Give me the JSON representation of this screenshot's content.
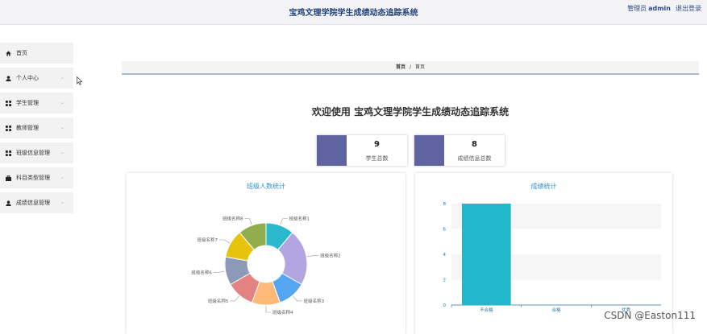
{
  "header": {
    "title": "宝鸡文理学院学生成绩动态追踪系统",
    "user_role": "管理员",
    "user_name": "admin",
    "logout": "退出登录"
  },
  "sidebar": {
    "items": [
      {
        "label": "首页",
        "icon": "home-icon"
      },
      {
        "label": "个人中心",
        "icon": "person-icon"
      },
      {
        "label": "学生管理",
        "icon": "grid-icon"
      },
      {
        "label": "教师管理",
        "icon": "grid-icon"
      },
      {
        "label": "班级信息管理",
        "icon": "grid-icon"
      },
      {
        "label": "科目类型管理",
        "icon": "briefcase-icon"
      },
      {
        "label": "成绩信息管理",
        "icon": "person-icon"
      }
    ]
  },
  "breadcrumb": {
    "first": "首页",
    "separator": "/",
    "second": "首页"
  },
  "welcome": "欢迎使用 宝鸡文理学院学生成绩动态追踪系统",
  "stats": [
    {
      "value": "9",
      "label": "学生总数"
    },
    {
      "value": "8",
      "label": "成绩信息总数"
    }
  ],
  "colors": {
    "accent": "#5f64a0",
    "title_blue": "#2a90c8",
    "bar": "#22b8cc"
  },
  "chart_data": [
    {
      "type": "pie",
      "title": "班级人数统计",
      "categories": [
        "班级名称1",
        "班级名称2",
        "班级名称3",
        "班级名称4",
        "班级名称5",
        "班级名称6",
        "班级名称7",
        "班级名称8"
      ],
      "values": [
        1,
        2,
        1,
        1,
        1,
        1,
        1,
        1
      ],
      "colors": [
        "#2ab9cc",
        "#b3a6e0",
        "#55a6f0",
        "#ffb878",
        "#e38381",
        "#8c9ab7",
        "#e6c40b",
        "#92ad4e"
      ]
    },
    {
      "type": "bar",
      "title": "成绩统计",
      "categories": [
        "不合格",
        "合格",
        "优秀"
      ],
      "values": [
        8,
        0,
        0
      ],
      "ylim": [
        0,
        8
      ],
      "yticks": [
        "0",
        "2",
        "4",
        "6",
        "8"
      ],
      "color": "#22b8cc"
    }
  ],
  "watermark": "CSDN @Easton111"
}
